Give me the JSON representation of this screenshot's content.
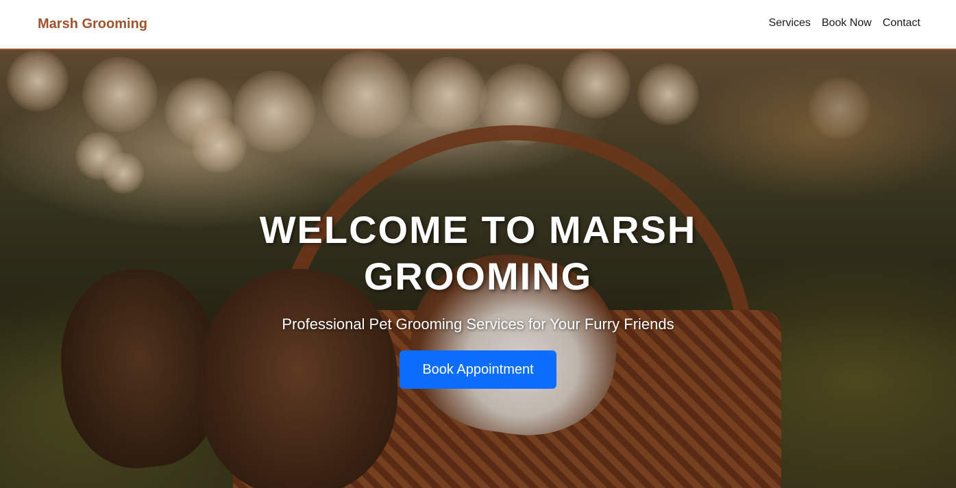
{
  "navbar": {
    "brand": "Marsh Grooming",
    "links": [
      {
        "label": "Services"
      },
      {
        "label": "Book Now"
      },
      {
        "label": "Contact"
      }
    ]
  },
  "hero": {
    "title": "WELCOME TO MARSH GROOMING",
    "subtitle": "Professional Pet Grooming Services for Your Furry Friends",
    "cta_label": "Book Appointment",
    "background_image": "puppies-in-wicker-basket-photo"
  },
  "colors": {
    "brand": "#a0522d",
    "nav_border": "#a0522d",
    "cta": "#0d6efd",
    "text_light": "#ffffff"
  }
}
